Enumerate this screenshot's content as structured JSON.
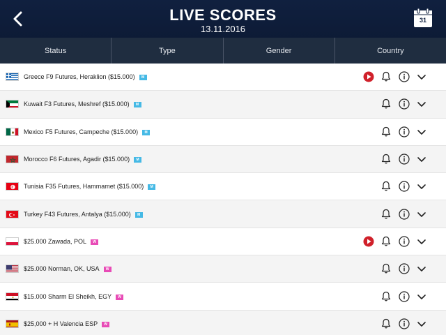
{
  "header": {
    "title": "LIVE SCORES",
    "date": "13.11.2016",
    "calendar_day": "31",
    "background": "#10203f"
  },
  "filters": [
    {
      "label": "Status"
    },
    {
      "label": "Type"
    },
    {
      "label": "Gender"
    },
    {
      "label": "Country"
    }
  ],
  "tournaments": [
    {
      "label": "Greece F9 Futures, Heraklion ($15.000)",
      "badge": "M",
      "flag": "greece",
      "live": true
    },
    {
      "label": "Kuwait F3 Futures, Meshref ($15.000)",
      "badge": "M",
      "flag": "kuwait",
      "live": false
    },
    {
      "label": "Mexico F5 Futures, Campeche ($15.000)",
      "badge": "M",
      "flag": "mexico",
      "live": false
    },
    {
      "label": "Morocco F6 Futures, Agadir ($15.000)",
      "badge": "M",
      "flag": "morocco",
      "live": false
    },
    {
      "label": "Tunisia F35 Futures, Hammamet ($15.000)",
      "badge": "M",
      "flag": "tunisia",
      "live": false
    },
    {
      "label": "Turkey F43 Futures, Antalya ($15.000)",
      "badge": "M",
      "flag": "turkey",
      "live": false
    },
    {
      "label": "$25.000 Zawada, POL",
      "badge": "W",
      "flag": "poland",
      "live": true
    },
    {
      "label": "$25.000 Norman, OK, USA",
      "badge": "W",
      "flag": "usa",
      "live": false
    },
    {
      "label": "$15.000 Sharm El Sheikh, EGY",
      "badge": "W",
      "flag": "egypt",
      "live": false
    },
    {
      "label": "$25,000 + H Valencia ESP",
      "badge": "W",
      "flag": "spain",
      "live": false
    }
  ],
  "icons": {
    "back": "chevron-left-icon",
    "calendar": "calendar-icon",
    "live": "play-icon",
    "alert": "bell-icon",
    "info": "info-icon",
    "expand": "chevron-down-icon"
  },
  "colors": {
    "filter_bar": "#1f2d40",
    "badge_men": "#45b9e5",
    "badge_women": "#e84bb6",
    "live_red": "#d0202a"
  }
}
